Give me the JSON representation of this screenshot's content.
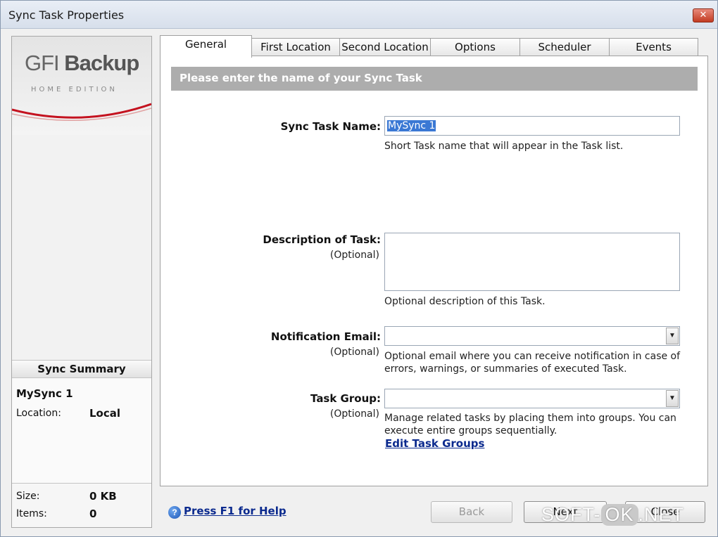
{
  "window": {
    "title": "Sync Task Properties",
    "close_label": "✕"
  },
  "logo": {
    "brand_gfi": "GFI",
    "brand_backup": "Backup",
    "edition": "HOME EDITION"
  },
  "summary": {
    "heading": "Sync Summary",
    "task_name": "MySync 1",
    "location_label": "Location:",
    "location_value": "Local",
    "size_label": "Size:",
    "size_value": "0 KB",
    "items_label": "Items:",
    "items_value": "0"
  },
  "tabs": [
    {
      "label": "General",
      "active": true
    },
    {
      "label": "First Location"
    },
    {
      "label": "Second Location"
    },
    {
      "label": "Options"
    },
    {
      "label": "Scheduler"
    },
    {
      "label": "Events"
    }
  ],
  "general": {
    "header": "Please enter the name of your Sync Task",
    "task_name": {
      "label": "Sync Task Name:",
      "value": "MySync 1",
      "help": "Short Task name that will appear in the Task list."
    },
    "description": {
      "label": "Description of Task:",
      "optional": "(Optional)",
      "value": "",
      "help": "Optional description of this Task."
    },
    "email": {
      "label": "Notification Email:",
      "optional": "(Optional)",
      "value": "",
      "help_line1": "Optional email where you can receive notification in case of",
      "help_line2": "errors, warnings, or summaries of executed Task."
    },
    "group": {
      "label": "Task Group:",
      "optional": "(Optional)",
      "value": "",
      "help_line1": "Manage related tasks by placing them into groups. You can",
      "help_line2": "execute entire groups sequentially.",
      "edit_link": "Edit Task Groups"
    }
  },
  "footer": {
    "help_link": "Press F1 for Help",
    "back_label": "Back",
    "next_label": "Next",
    "close_label": "Close"
  },
  "watermark": {
    "part1": "SOFT-",
    "part2": "OK",
    "part3": ".NET"
  },
  "colors": {
    "section_header": "#adadad",
    "link": "#0b2a8e",
    "selection": "#3a78d4"
  }
}
